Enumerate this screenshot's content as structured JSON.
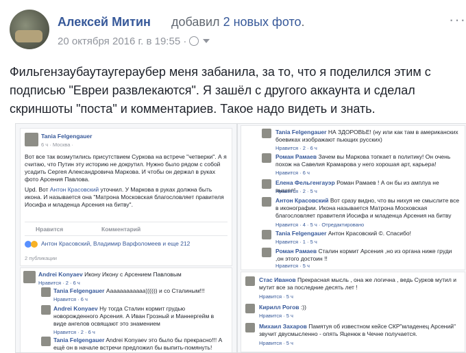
{
  "post": {
    "author": "Алексей Митин",
    "action_prefix": "добавил",
    "action_link": "2 новых фото",
    "action_suffix": ".",
    "timestamp": "20 октября 2016 г. в 19:55 ·",
    "more": "···",
    "text": "Фильгензаубаутаугераубер меня забанила, за то, что я поделился этим с подписью \"Евреи развлекаются\". Я зашёл с другого аккаунта и сделал скриншоты \"поста\" и комментариев. Такое надо видеть и знать."
  },
  "photo1": {
    "author": "Tania Felgengauer",
    "meta": "6 ч · Москва ·",
    "body1": "Вот все так возмутились присутствием Суркова на встрече \"четверки\". А я считаю, что Путин эту историю не докрутил. Нужно было рядом с собой усадить Сергея Александровича Маркова. И чтобы он держал в руках фото Арсения Павлова.",
    "body2_prefix": "Upd. Вот ",
    "body2_link": "Антон Красовский",
    "body2_rest": " уточнил. У Маркова в руках должна быть икона. И называется она \"Матрона Московская благословляет правителя Иосифа и младенца Арсения на битву\".",
    "like": "Нравится",
    "comment": "Комментарий",
    "reactions": "Антон Красовский, Владимир Варфоломеев и еще 212",
    "shares": "2 публикации",
    "comments": [
      {
        "name": "Andrei Konyaev",
        "text": "Икону Икону с Арсением Павловым",
        "meta": "Нравится · 2 · 6 ч"
      },
      {
        "name": "Tania Felgengauer",
        "text": "Аааааааааааа)))))) и со Сталиным!!!",
        "meta": "Нравится · 6 ч"
      },
      {
        "name": "Andrei Konyaev",
        "text": "Ну тогда Сталин кормит грудью новорожденного Арсения. А Иван Грозный и Маннергейм в виде ангелов освящают это знамением",
        "meta": "Нравится · 2 · 6 ч"
      },
      {
        "name": "Tania Felgengauer",
        "text": "Andrei Konyaev это было бы прекрасно!!! А ещё он в начале встречи предложил бы выпить-помянуть!",
        "meta": ""
      }
    ]
  },
  "photo2": {
    "comments": [
      {
        "name": "Tania Felgengauer",
        "text": "НА ЗДОРОВЬЕ! (ну или как там в американских боевиках изображают пьющих русских)",
        "meta": "Нравится · 2 · 6 ч"
      },
      {
        "name": "Роман Рамаев",
        "text": "Зачем вы Маркова топкает в политику! Он очень похож на Савелия Крамарова у него хорошая арт, карьера!",
        "meta": "Нравится · 6 ч"
      },
      {
        "name": "Елена Фельгенгауэр",
        "text": "Роман Рамаев ! А он бы из амплуа не вышел!",
        "meta": "Нравится · 2 · 5 ч"
      },
      {
        "name": "Антон Красовский",
        "text": "Вот сразу видно, что вы нихуя не смыслите все в иконографии. Икона называется Матрона Московская благословляет правителя Иосифа и младенца Арсения на битву",
        "meta": "Нравится · 4 · 5 ч · Отредактировано"
      },
      {
        "name": "Tania Felgengauer",
        "text": "Антон Красовский ©. Спасибо!",
        "meta": "Нравится · 1 · 5 ч"
      },
      {
        "name": "Роман Рамаев",
        "text": "Сталин кормит Арсения ,но из органа ниже груди ,он этого достоин !!",
        "meta": "Нравится · 5 ч"
      },
      {
        "name": "Стас Иванов",
        "text": "Прекрасная мысль , она же логична , ведь Сурков мутил и мутит все за последние десять лет !",
        "meta": "Нравится · 5 ч"
      },
      {
        "name": "Кирилл Рогов",
        "text": ":))",
        "meta": "Нравится · 5 ч"
      },
      {
        "name": "Михаил Захаров",
        "text": "Памятуя об известном кейсе СКР\"младенец Арсений\" звучит двусмысленно - опять Яценюк в Чечне получается.",
        "meta": "Нравится · 5 ч"
      }
    ]
  }
}
